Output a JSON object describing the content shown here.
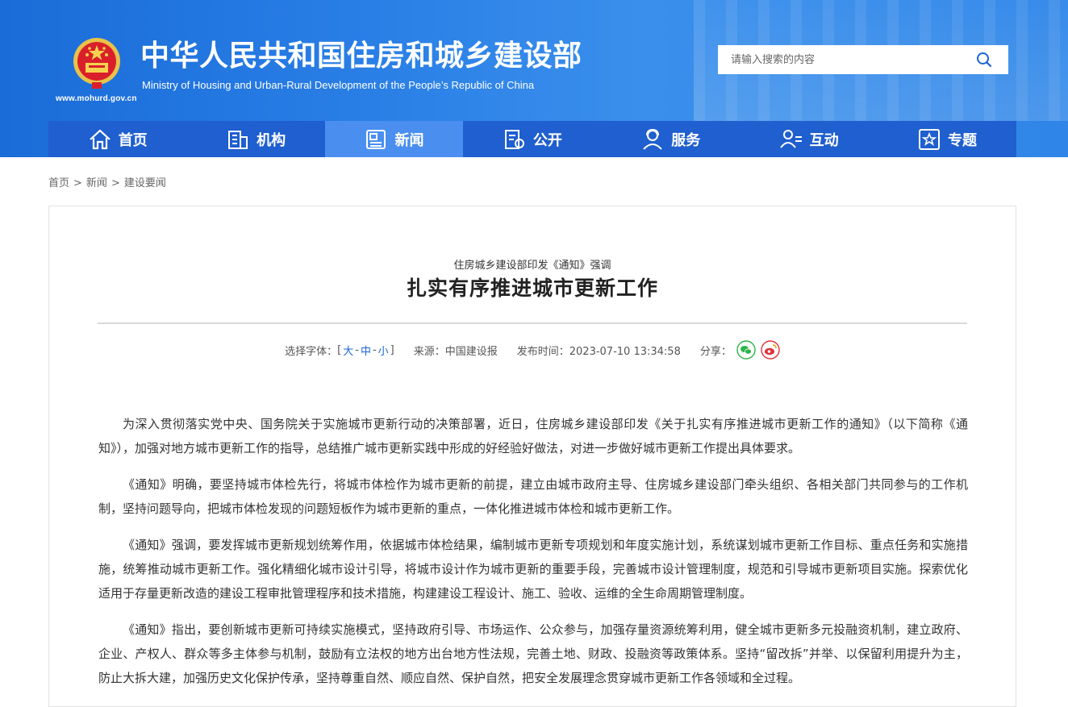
{
  "header": {
    "title": "中华人民共和国住房和城乡建设部",
    "subtitle": "Ministry of Housing and Urban-Rural Development of the People’s Republic of China",
    "url": "www.mohurd.gov.cn",
    "search_placeholder": "请输入搜索的内容"
  },
  "nav": {
    "items": [
      {
        "label": "首页",
        "icon": "home-icon"
      },
      {
        "label": "机构",
        "icon": "building-icon"
      },
      {
        "label": "新闻",
        "icon": "news-icon",
        "active": true
      },
      {
        "label": "公开",
        "icon": "document-icon"
      },
      {
        "label": "服务",
        "icon": "service-icon"
      },
      {
        "label": "互动",
        "icon": "interaction-icon"
      },
      {
        "label": "专题",
        "icon": "star-icon"
      }
    ]
  },
  "breadcrumb": [
    "首页",
    "新闻",
    "建设要闻"
  ],
  "article": {
    "kicker": "住房城乡建设部印发《通知》强调",
    "title": "扎实有序推进城市更新工作",
    "meta": {
      "font_label": "选择字体：",
      "font_bracket_open": "[",
      "font_large": "大",
      "font_medium": "中",
      "font_small": "小",
      "font_bracket_close": "]",
      "source": "来源：中国建设报",
      "published": "发布时间：2023-07-10 13:34:58",
      "share_label": "分享："
    },
    "paragraphs": [
      "为深入贯彻落实党中央、国务院关于实施城市更新行动的决策部署，近日，住房城乡建设部印发《关于扎实有序推进城市更新工作的通知》（以下简称《通知》），加强对地方城市更新工作的指导，总结推广城市更新实践中形成的好经验好做法，对进一步做好城市更新工作提出具体要求。",
      "《通知》明确，要坚持城市体检先行，将城市体检作为城市更新的前提，建立由城市政府主导、住房城乡建设部门牵头组织、各相关部门共同参与的工作机制，坚持问题导向，把城市体检发现的问题短板作为城市更新的重点，一体化推进城市体检和城市更新工作。",
      "《通知》强调，要发挥城市更新规划统筹作用，依据城市体检结果，编制城市更新专项规划和年度实施计划，系统谋划城市更新工作目标、重点任务和实施措施，统筹推动城市更新工作。强化精细化城市设计引导，将城市设计作为城市更新的重要手段，完善城市设计管理制度，规范和引导城市更新项目实施。探索优化适用于存量更新改造的建设工程审批管理程序和技术措施，构建建设工程设计、施工、验收、运维的全生命周期管理制度。",
      "《通知》指出，要创新城市更新可持续实施模式，坚持政府引导、市场运作、公众参与，加强存量资源统筹利用，健全城市更新多元投融资机制，建立政府、企业、产权人、群众等多主体参与机制，鼓励有立法权的地方出台地方性法规，完善土地、财政、投融资等政策体系。坚持“留改拆”并举、以保留利用提升为主，防止大拆大建，加强历史文化保护传承，坚持尊重自然、顺应自然、保护自然，把安全发展理念贯穿城市更新工作各领域和全过程。"
    ]
  },
  "colors": {
    "header_blue": "#2a7fe6",
    "nav_blue": "#1f5fcf",
    "nav_active": "#4a8ff0",
    "link_blue": "#1a64d6",
    "wechat_green": "#2fb34a",
    "weibo_red": "#e0323a"
  }
}
